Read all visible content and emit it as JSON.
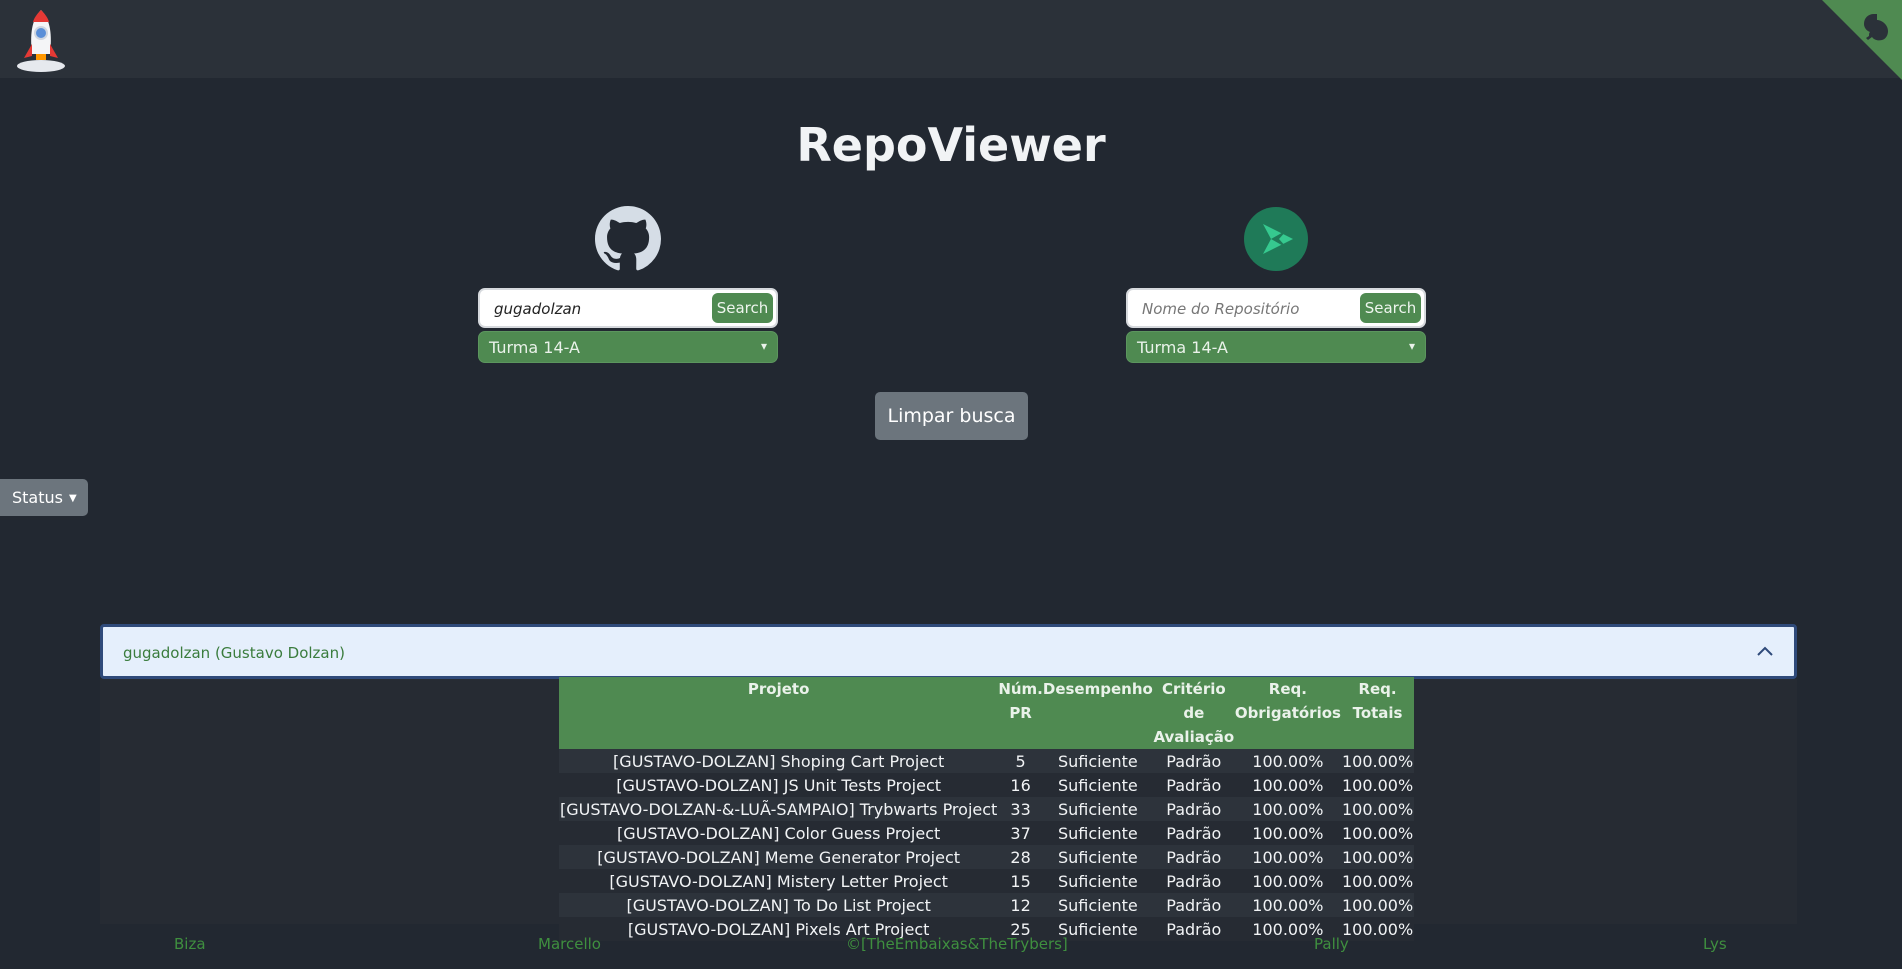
{
  "app": {
    "title": "RepoViewer"
  },
  "search_user": {
    "value": "gugadolzan",
    "placeholder": "",
    "button_label": "Search",
    "turma": "Turma 14-A"
  },
  "search_repo": {
    "value": "",
    "placeholder": "Nome do Repositório",
    "button_label": "Search",
    "turma": "Turma 14-A"
  },
  "clear_button": "Limpar busca",
  "status_dropdown": "Status",
  "accordion": {
    "header": "gugadolzan (Gustavo Dolzan)"
  },
  "table": {
    "headers": [
      "Projeto",
      "Núm. PR",
      "Desempenho",
      "Critério de Avaliação",
      "Req. Obrigatórios",
      "Req. Totais"
    ],
    "rows": [
      [
        "[GUSTAVO-DOLZAN] Shoping Cart Project",
        "5",
        "Suficiente",
        "Padrão",
        "100.00%",
        "100.00%"
      ],
      [
        "[GUSTAVO-DOLZAN] JS Unit Tests Project",
        "16",
        "Suficiente",
        "Padrão",
        "100.00%",
        "100.00%"
      ],
      [
        "[GUSTAVO-DOLZAN-&-LUÃ-SAMPAIO] Trybwarts Project",
        "33",
        "Suficiente",
        "Padrão",
        "100.00%",
        "100.00%"
      ],
      [
        "[GUSTAVO-DOLZAN] Color Guess Project",
        "37",
        "Suficiente",
        "Padrão",
        "100.00%",
        "100.00%"
      ],
      [
        "[GUSTAVO-DOLZAN] Meme Generator Project",
        "28",
        "Suficiente",
        "Padrão",
        "100.00%",
        "100.00%"
      ],
      [
        "[GUSTAVO-DOLZAN] Mistery Letter Project",
        "15",
        "Suficiente",
        "Padrão",
        "100.00%",
        "100.00%"
      ],
      [
        "[GUSTAVO-DOLZAN] To Do List Project",
        "12",
        "Suficiente",
        "Padrão",
        "100.00%",
        "100.00%"
      ],
      [
        "[GUSTAVO-DOLZAN] Pixels Art Project",
        "25",
        "Suficiente",
        "Padrão",
        "100.00%",
        "100.00%"
      ]
    ]
  },
  "footer": {
    "links": [
      "Biza",
      "Marcello",
      "©[TheEmbaixas&TheTrybers]",
      "Pally",
      "Lys"
    ]
  },
  "icons": {
    "logo": "rocket-logo-icon",
    "github": "github-icon",
    "trybe": "trybe-icon",
    "corner": "github-corner-icon",
    "chevron": "chevron-up-icon"
  },
  "colors": {
    "background": "#222831",
    "navbar": "#2b3139",
    "accent_green": "#4f8a51",
    "footer_link": "#3f8f3f",
    "accordion_header": "#e5effc"
  }
}
